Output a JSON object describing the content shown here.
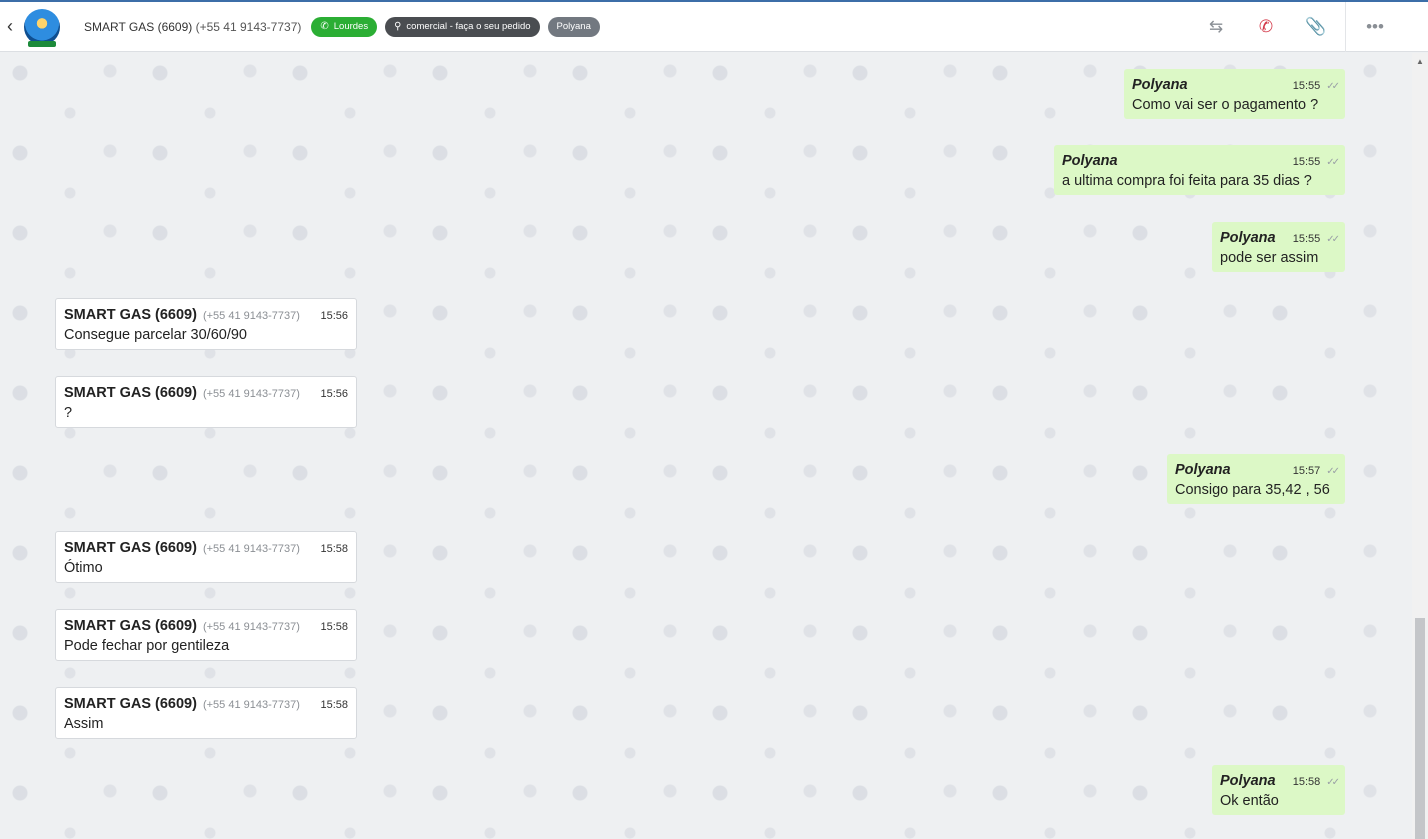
{
  "header": {
    "back_icon": "chevron-left-icon",
    "contact_name": "SMART GAS (6609)",
    "contact_phone": "(+55 41 9143-7737)",
    "tags": [
      {
        "label": "Lourdes",
        "icon": "whatsapp-icon",
        "color": "#2bae34"
      },
      {
        "label": "comercial - faça o seu pedido",
        "icon": "org-chart-icon",
        "color": "#4a4d51"
      },
      {
        "label": "Polyana",
        "color": "#727880"
      }
    ],
    "actions": [
      "transfer-icon",
      "hangup-icon",
      "attach-icon",
      "more-icon"
    ]
  },
  "messages": [
    {
      "dir": "out",
      "sender": "Polyana",
      "time": "15:55",
      "text": "Como vai ser o pagamento ?"
    },
    {
      "dir": "out",
      "sender": "Polyana",
      "time": "15:55",
      "text": "a ultima compra foi feita para 35 dias ?"
    },
    {
      "dir": "out",
      "sender": "Polyana",
      "time": "15:55",
      "text": "pode ser assim"
    },
    {
      "dir": "in",
      "sender": "SMART GAS (6609)",
      "phone": "(+55 41 9143-7737)",
      "time": "15:56",
      "text": "Consegue parcelar 30/60/90"
    },
    {
      "dir": "in",
      "sender": "SMART GAS (6609)",
      "phone": "(+55 41 9143-7737)",
      "time": "15:56",
      "text": "?"
    },
    {
      "dir": "out",
      "sender": "Polyana",
      "time": "15:57",
      "text": "Consigo para 35,42 , 56"
    },
    {
      "dir": "in",
      "sender": "SMART GAS (6609)",
      "phone": "(+55 41 9143-7737)",
      "time": "15:58",
      "text": "Ótimo"
    },
    {
      "dir": "in",
      "sender": "SMART GAS (6609)",
      "phone": "(+55 41 9143-7737)",
      "time": "15:58",
      "text": "Pode fechar por gentileza"
    },
    {
      "dir": "in",
      "sender": "SMART GAS (6609)",
      "phone": "(+55 41 9143-7737)",
      "time": "15:58",
      "text": "Assim"
    },
    {
      "dir": "out",
      "sender": "Polyana",
      "time": "15:58",
      "text": "Ok então"
    }
  ],
  "colors": {
    "outgoing_bubble": "#dcf8c6",
    "incoming_bubble": "#ffffff",
    "accent_border": "#3c6ea8"
  }
}
